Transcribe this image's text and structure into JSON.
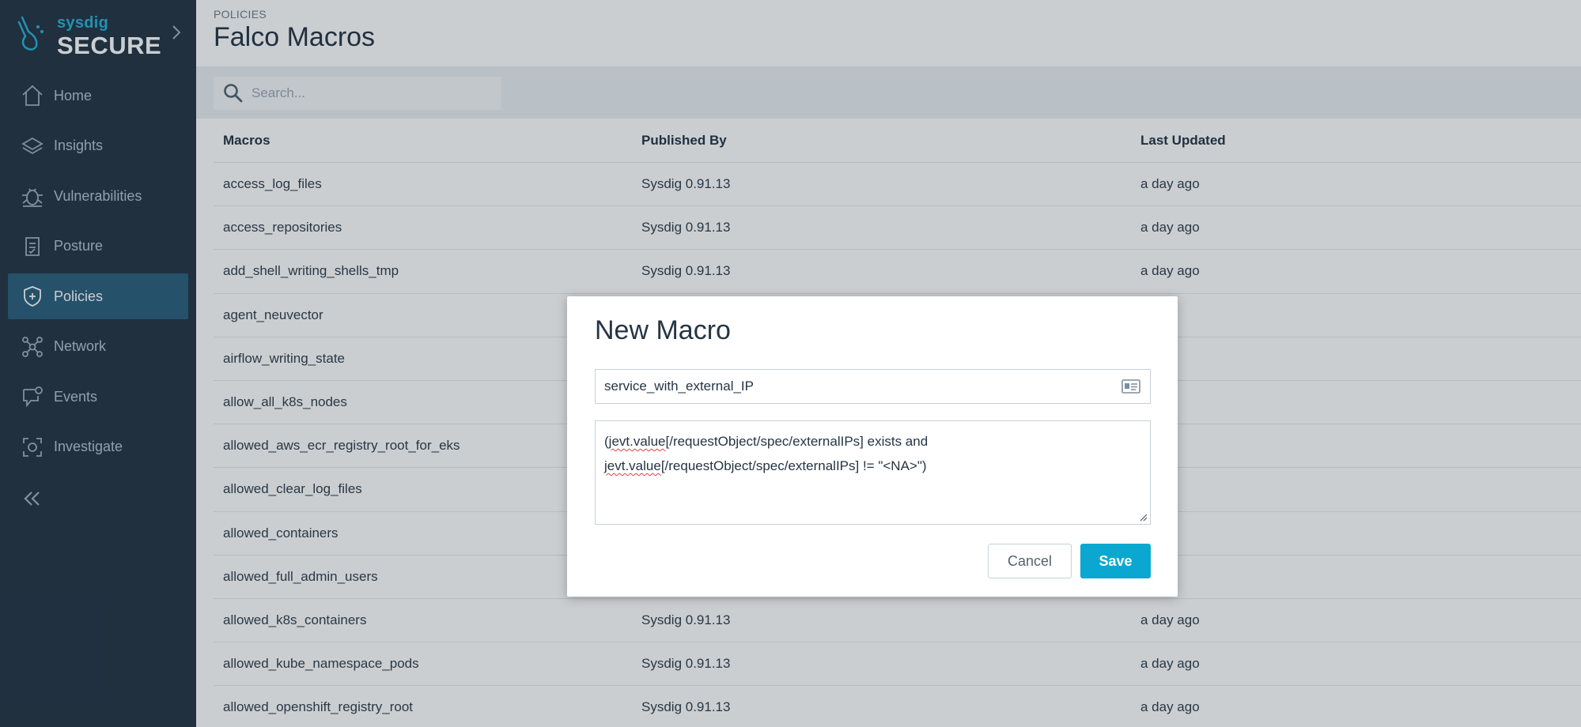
{
  "brand": {
    "small": "sysdig",
    "big": "SECURE"
  },
  "nav": {
    "items": [
      {
        "label": "Home",
        "icon": "home-icon"
      },
      {
        "label": "Insights",
        "icon": "layers-icon"
      },
      {
        "label": "Vulnerabilities",
        "icon": "bug-icon"
      },
      {
        "label": "Posture",
        "icon": "checklist-icon"
      },
      {
        "label": "Policies",
        "icon": "shield-icon",
        "active": true
      },
      {
        "label": "Network",
        "icon": "network-icon"
      },
      {
        "label": "Events",
        "icon": "chat-icon"
      },
      {
        "label": "Investigate",
        "icon": "investigate-icon"
      }
    ],
    "collapse_icon": "double-chevron-left-icon"
  },
  "header": {
    "breadcrumb": "POLICIES",
    "title": "Falco Macros"
  },
  "search": {
    "placeholder": "Search..."
  },
  "table": {
    "columns": [
      "Macros",
      "Published By",
      "Last Updated"
    ],
    "rows": [
      [
        "access_log_files",
        "Sysdig 0.91.13",
        "a day ago"
      ],
      [
        "access_repositories",
        "Sysdig 0.91.13",
        "a day ago"
      ],
      [
        "add_shell_writing_shells_tmp",
        "Sysdig 0.91.13",
        "a day ago"
      ],
      [
        "agent_neuvector",
        "",
        "y ago"
      ],
      [
        "airflow_writing_state",
        "",
        "y ago"
      ],
      [
        "allow_all_k8s_nodes",
        "",
        "y ago"
      ],
      [
        "allowed_aws_ecr_registry_root_for_eks",
        "",
        "y ago"
      ],
      [
        "allowed_clear_log_files",
        "",
        "y ago"
      ],
      [
        "allowed_containers",
        "",
        "y ago"
      ],
      [
        "allowed_full_admin_users",
        "",
        "y ago"
      ],
      [
        "allowed_k8s_containers",
        "Sysdig 0.91.13",
        "a day ago"
      ],
      [
        "allowed_kube_namespace_pods",
        "Sysdig 0.91.13",
        "a day ago"
      ],
      [
        "allowed_openshift_registry_root",
        "Sysdig 0.91.13",
        "a day ago"
      ]
    ]
  },
  "modal": {
    "title": "New Macro",
    "name_value": "service_with_external_IP",
    "condition": {
      "line1_pre": "(",
      "line1_sq": "jevt.value",
      "line1_post": "[/requestObject/spec/externalIPs] exists and",
      "line2_sq": "jevt.value",
      "line2_post": "[/requestObject/spec/externalIPs] != \"<NA>\")"
    },
    "cancel_label": "Cancel",
    "save_label": "Save"
  },
  "colors": {
    "sidebar": "#253545",
    "active_nav": "#2b5f7b",
    "accent": "#0aa8d0",
    "brand": "#27b3d6"
  }
}
